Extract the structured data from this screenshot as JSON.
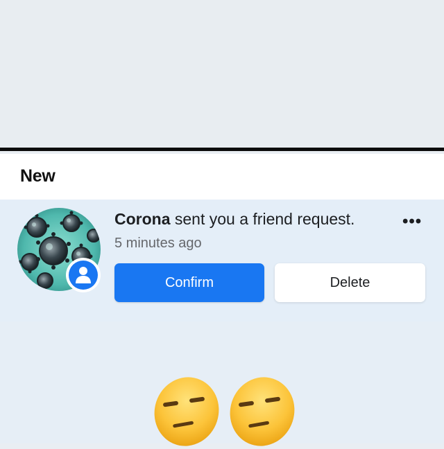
{
  "section": {
    "title": "New"
  },
  "notification": {
    "sender": "Corona",
    "message_rest": " sent you a friend request.",
    "time": "5 minutes ago",
    "more_label": "•••",
    "confirm_label": "Confirm",
    "delete_label": "Delete",
    "avatar": "coronavirus-image",
    "badge_icon": "person-icon"
  },
  "reaction": {
    "emojis": [
      "expressionless-face",
      "expressionless-face"
    ]
  },
  "colors": {
    "accent": "#1977f2",
    "background": "#e9eef3",
    "notification_bg": "#e4eef8",
    "divider": "#0c0c0c"
  }
}
